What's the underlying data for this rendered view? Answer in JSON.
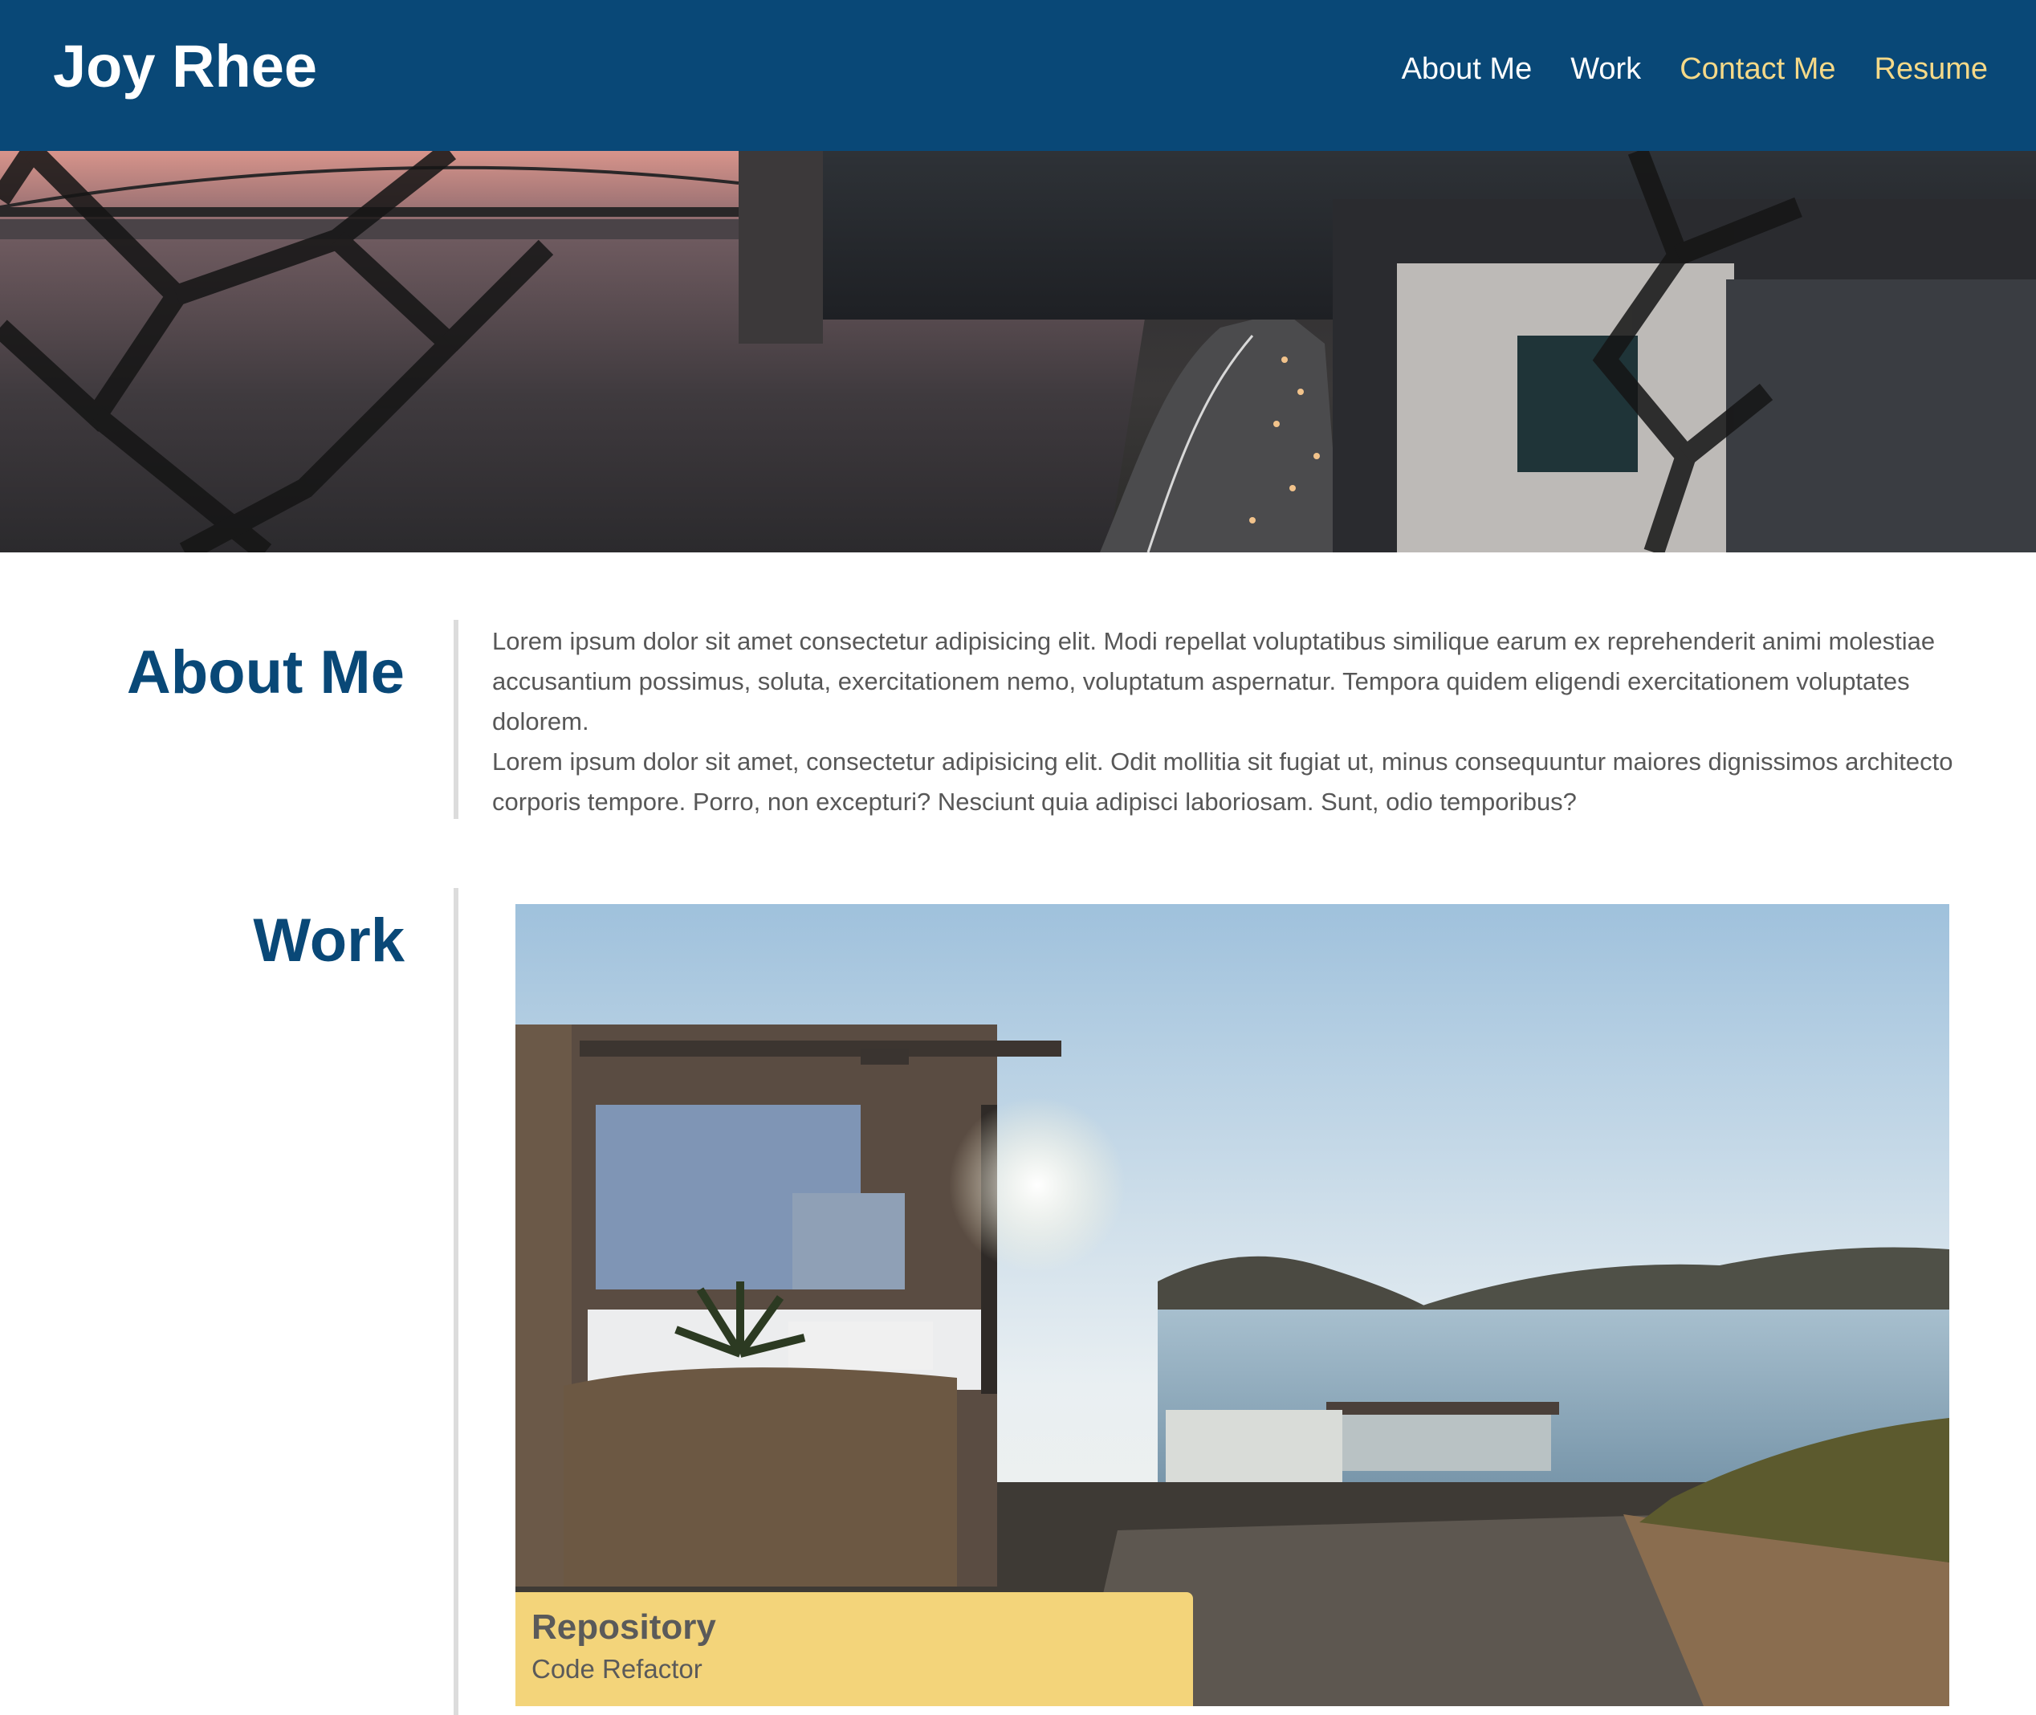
{
  "header": {
    "title": "Joy Rhee",
    "nav": [
      {
        "label": "About Me",
        "color": "#ffffff"
      },
      {
        "label": "Work",
        "color": "#ffffff"
      },
      {
        "label": "Contact Me",
        "color": "#f5d988"
      },
      {
        "label": "Resume",
        "color": "#f5d988"
      }
    ],
    "background": "#094877"
  },
  "hero": {
    "image": "city-bridge-highway-photo"
  },
  "about": {
    "heading": "About Me",
    "paragraphs": [
      "Lorem ipsum dolor sit amet consectetur adipisicing elit. Modi repellat voluptatibus similique earum ex reprehenderit animi molestiae accusantium possimus, soluta, exercitationem nemo, voluptatum aspernatur. Tempora quidem eligendi exercitationem voluptates dolorem.",
      "Lorem ipsum dolor sit amet, consectetur adipisicing elit. Odit mollitia sit fugiat ut, minus consequuntur maiores dignissimos architecto corporis tempore. Porro, non excepturi? Nesciunt quia adipisci laboriosam. Sunt, odio temporibus?"
    ]
  },
  "work": {
    "heading": "Work",
    "project": {
      "image": "seaside-house-photo",
      "title": "Repository",
      "subtitle": "Code Refactor",
      "caption_color": "#f3d47a"
    }
  },
  "colors": {
    "heading": "#094877",
    "body_text": "#575757",
    "divider": "#dcdcdc"
  }
}
